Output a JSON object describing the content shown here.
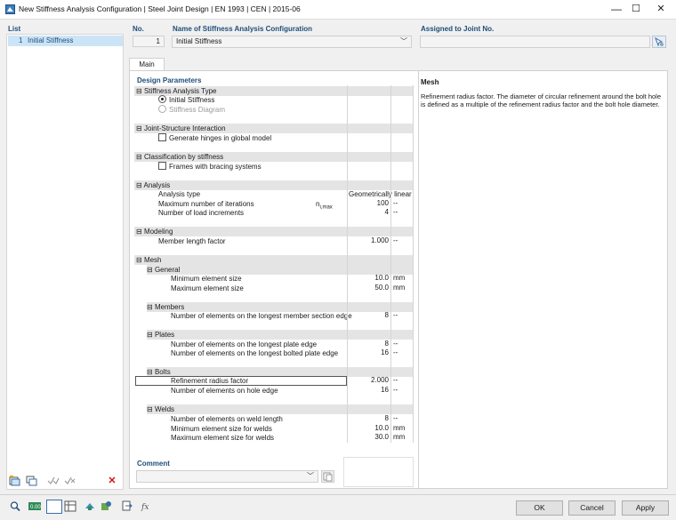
{
  "window": {
    "title": "New Stiffness Analysis Configuration | Steel Joint Design | EN 1993 | CEN | 2015-06",
    "minimize": "—",
    "maximize": "☐",
    "close": "✕"
  },
  "list": {
    "header": "List",
    "items": [
      {
        "no": "1",
        "label": "Initial Stiffness"
      }
    ]
  },
  "header": {
    "no_label": "No.",
    "no_value": "1",
    "name_label": "Name of Stiffness Analysis Configuration",
    "name_value": "Initial Stiffness",
    "assigned_label": "Assigned to Joint No.",
    "assigned_value": ""
  },
  "tabs": {
    "main": "Main"
  },
  "design": {
    "title": "Design Parameters",
    "sat": {
      "label": "Stiffness Analysis Type",
      "opt1": "Initial Stiffness",
      "opt2": "Stiffness Diagram"
    },
    "jsi": {
      "label": "Joint-Structure Interaction",
      "opt": "Generate hinges in global model"
    },
    "cls": {
      "label": "Classification by stiffness",
      "opt": "Frames with bracing systems"
    },
    "analysis": {
      "label": "Analysis",
      "type_label": "Analysis type",
      "type_value": "Geometrically linear",
      "iter_label": "Maximum number of iterations",
      "iter_sym": "n",
      "iter_sub": "i,max",
      "iter_value": "100",
      "iter_unit": "--",
      "inc_label": "Number of load increments",
      "inc_value": "4",
      "inc_unit": "--"
    },
    "modeling": {
      "label": "Modeling",
      "mlf_label": "Member length factor",
      "mlf_value": "1.000",
      "mlf_unit": "--"
    },
    "mesh": {
      "label": "Mesh",
      "general": {
        "label": "General",
        "min_label": "Minimum element size",
        "min_value": "10.0",
        "min_unit": "mm",
        "max_label": "Maximum element size",
        "max_value": "50.0",
        "max_unit": "mm"
      },
      "members": {
        "label": "Members",
        "n_label": "Number of elements on the longest member section edge",
        "n_value": "8",
        "n_unit": "--"
      },
      "plates": {
        "label": "Plates",
        "a_label": "Number of elements on the longest plate edge",
        "a_value": "8",
        "a_unit": "--",
        "b_label": "Number of elements on the longest bolted plate edge",
        "b_value": "16",
        "b_unit": "--"
      },
      "bolts": {
        "label": "Bolts",
        "r_label": "Refinement radius factor",
        "r_value": "2.000",
        "r_unit": "--",
        "h_label": "Number of elements on hole edge",
        "h_value": "16",
        "h_unit": "--"
      },
      "welds": {
        "label": "Welds",
        "a_label": "Number of elements on weld length",
        "a_value": "8",
        "a_unit": "--",
        "b_label": "Minimum element size for welds",
        "b_value": "10.0",
        "b_unit": "mm",
        "c_label": "Maximum element size for welds",
        "c_value": "30.0",
        "c_unit": "mm"
      }
    }
  },
  "info": {
    "title": "Mesh",
    "text": "Refinement radius factor. The diameter of circular refinement around the bolt hole is defined as a multiple of the refinement radius factor and the bolt hole diameter."
  },
  "comment": {
    "label": "Comment",
    "value": ""
  },
  "collapse": "⊟",
  "buttons": {
    "ok": "OK",
    "cancel": "Cancel",
    "apply": "Apply"
  },
  "icons": {
    "delete": "✕"
  }
}
